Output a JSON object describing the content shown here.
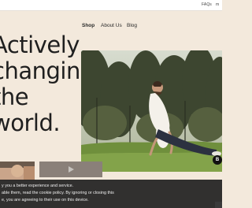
{
  "topbar": {
    "faqs": "FAQs",
    "more": "m"
  },
  "nav": {
    "shop": "Shop",
    "about": "About Us",
    "blog": "Blog"
  },
  "hero": {
    "lines": [
      "Actively",
      "changing",
      "the",
      "world."
    ]
  },
  "chat_label": "B",
  "cookie": {
    "lines": [
      "y you a better experience and service.",
      "able them, read the cookie policy. By ignoring or closing this",
      "e, you are agreeing to their use on this device."
    ]
  },
  "colors": {
    "background": "#f3e9dc",
    "cookie_bg": "#1c1c1c",
    "grass": "#6f8f3c"
  }
}
